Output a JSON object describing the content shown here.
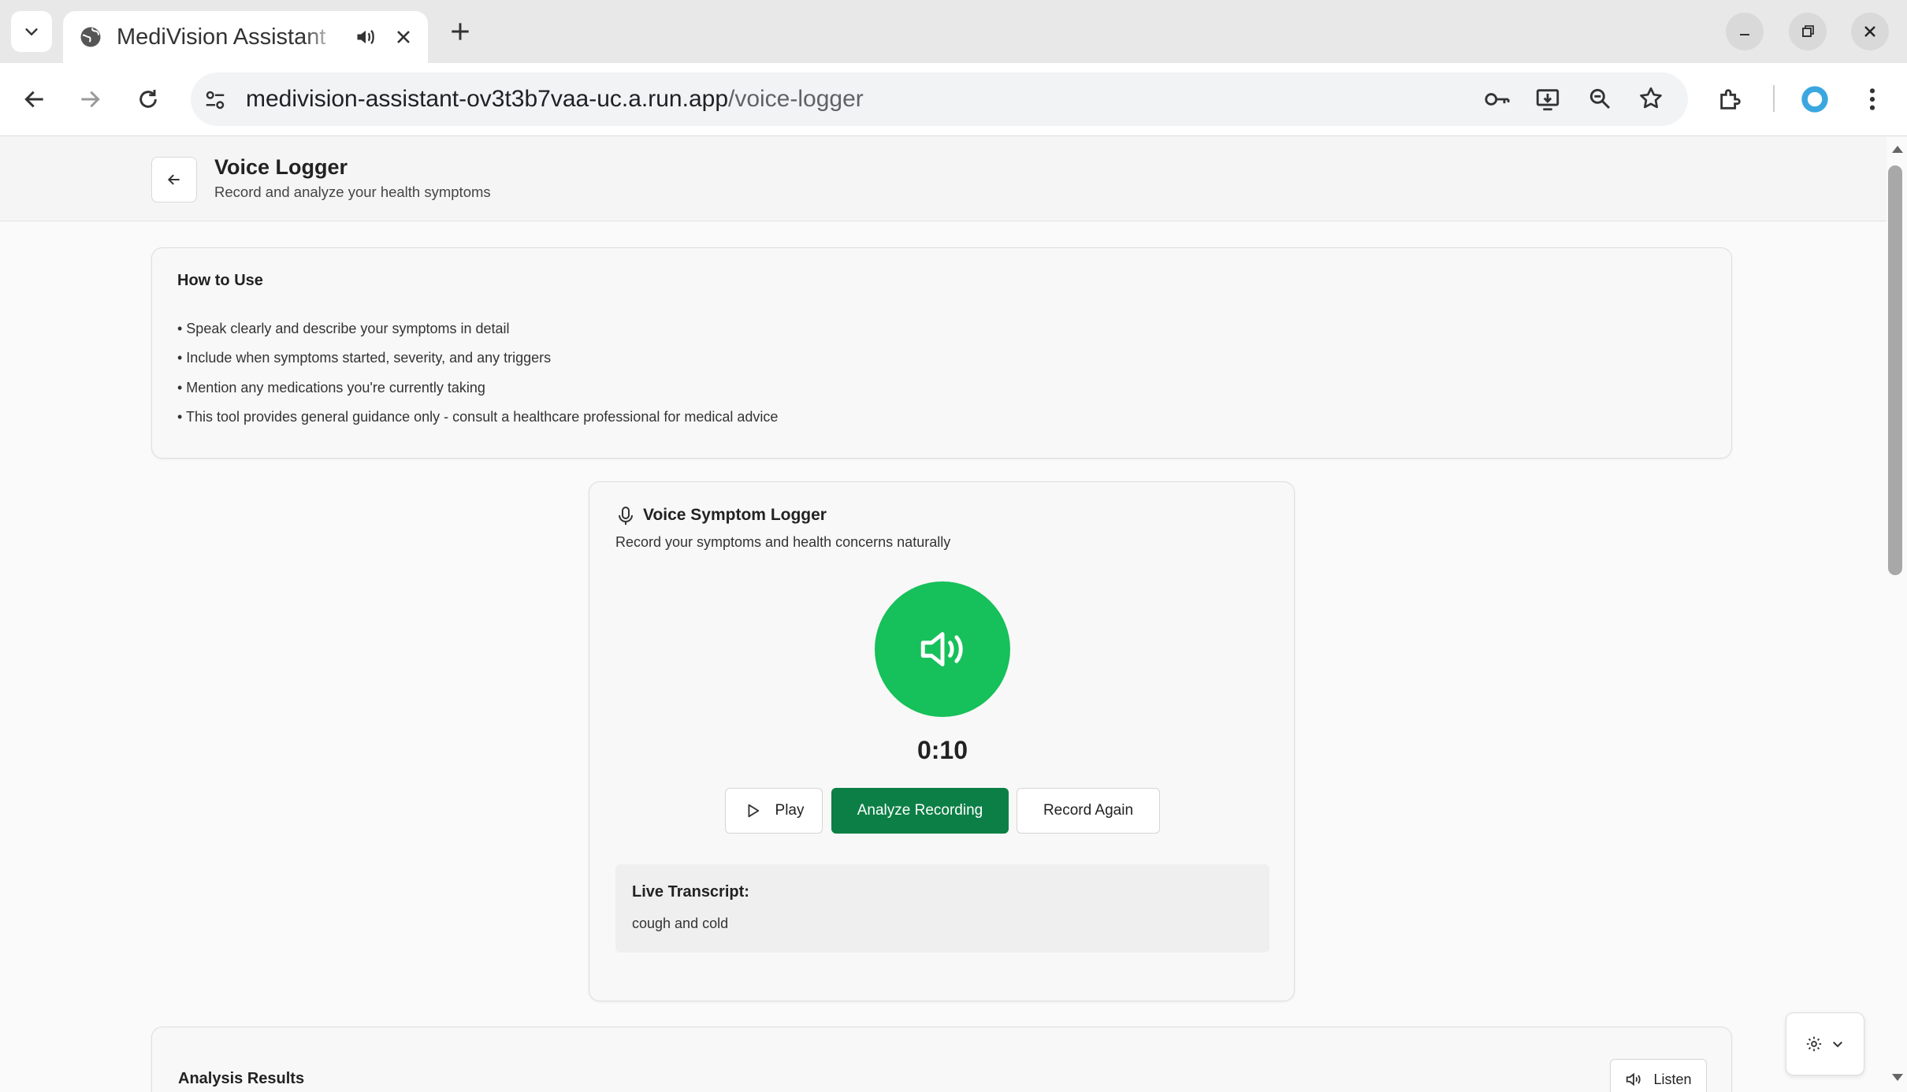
{
  "browser": {
    "tab_title": "MediVision Assistant",
    "url_host": "medivision-assistant-ov3t3b7vaa-uc.a.run.app",
    "url_path": "/voice-logger"
  },
  "header": {
    "title": "Voice Logger",
    "subtitle": "Record and analyze your health symptoms"
  },
  "how_to": {
    "title": "How to Use",
    "items": [
      "• Speak clearly and describe your symptoms in detail",
      "• Include when symptoms started, severity, and any triggers",
      "• Mention any medications you're currently taking",
      "• This tool provides general guidance only - consult a healthcare professional for medical advice"
    ]
  },
  "logger": {
    "title": "Voice Symptom Logger",
    "subtitle": "Record your symptoms and health concerns naturally",
    "timer": "0:10",
    "play_label": "Play",
    "analyze_label": "Analyze Recording",
    "record_again_label": "Record Again",
    "transcript_label": "Live Transcript:",
    "transcript_text": "cough and cold",
    "accent_color": "#16c05a",
    "primary_button_color": "#0c7f46"
  },
  "results": {
    "title": "Analysis Results",
    "listen_label": "Listen"
  }
}
